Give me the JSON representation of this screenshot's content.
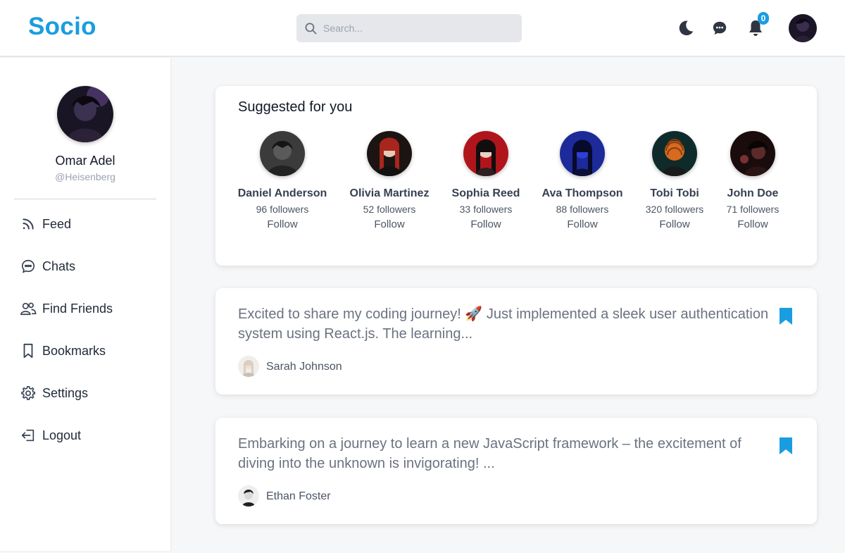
{
  "header": {
    "logo": "Socio",
    "search_placeholder": "Search...",
    "notification_count": "0",
    "icons": [
      "moon-icon",
      "chat-icon",
      "bell-icon"
    ]
  },
  "sidebar": {
    "profile": {
      "name": "Omar Adel",
      "handle": "@Heisenberg"
    },
    "items": [
      {
        "label": "Feed",
        "icon": "rss-icon"
      },
      {
        "label": "Chats",
        "icon": "chat-bubble-icon"
      },
      {
        "label": "Find Friends",
        "icon": "users-icon"
      },
      {
        "label": "Bookmarks",
        "icon": "bookmark-icon"
      },
      {
        "label": "Settings",
        "icon": "gear-icon"
      },
      {
        "label": "Logout",
        "icon": "logout-icon"
      }
    ]
  },
  "suggestions": {
    "title": "Suggested for you",
    "users": [
      {
        "name": "Daniel Anderson",
        "followers": "96 followers",
        "action": "Follow"
      },
      {
        "name": "Olivia Martinez",
        "followers": "52 followers",
        "action": "Follow"
      },
      {
        "name": "Sophia Reed",
        "followers": "33 followers",
        "action": "Follow"
      },
      {
        "name": "Ava Thompson",
        "followers": "88 followers",
        "action": "Follow"
      },
      {
        "name": "Tobi Tobi",
        "followers": "320 followers",
        "action": "Follow"
      },
      {
        "name": "John Doe",
        "followers": "71 followers",
        "action": "Follow"
      }
    ]
  },
  "posts": [
    {
      "text": "Excited to share my coding journey! 🚀 Just implemented a sleek user authentication system using React.js. The learning...",
      "author": "Sarah Johnson"
    },
    {
      "text": "Embarking on a journey to learn a new JavaScript framework – the excitement of diving into the unknown is invigorating! ...",
      "author": "Ethan Foster"
    }
  ],
  "colors": {
    "accent": "#1a9de0",
    "background": "#f6f7f9",
    "card": "#ffffff",
    "text_muted": "#6b7280"
  }
}
